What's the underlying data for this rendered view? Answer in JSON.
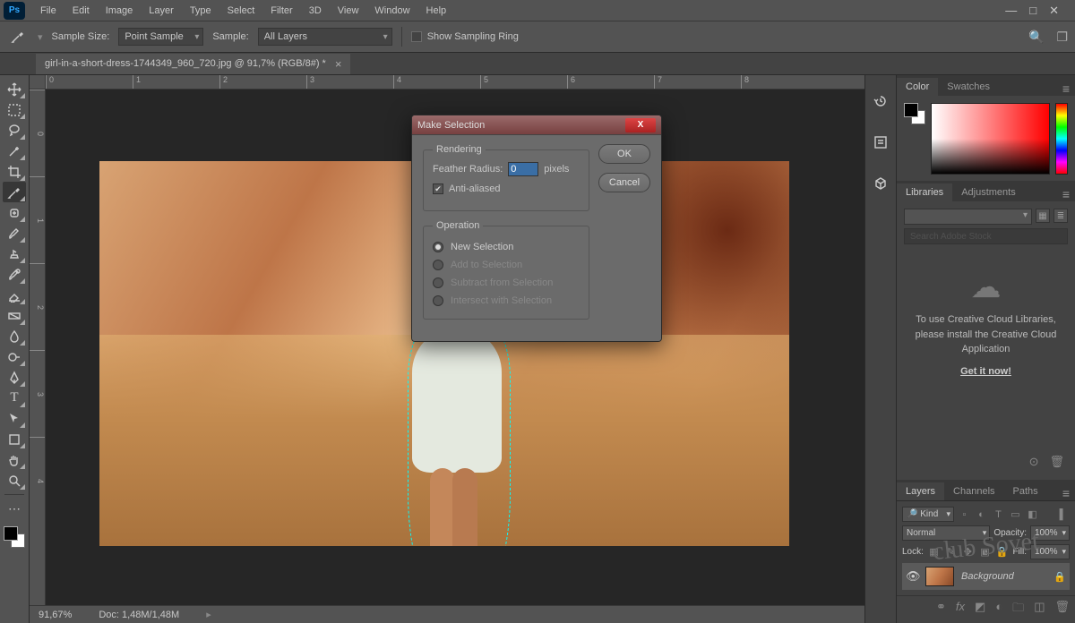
{
  "menubar": {
    "items": [
      "File",
      "Edit",
      "Image",
      "Layer",
      "Type",
      "Select",
      "Filter",
      "3D",
      "View",
      "Window",
      "Help"
    ]
  },
  "window_controls": {
    "min": "—",
    "max": "□",
    "close": "✕"
  },
  "optionsbar": {
    "sample_size_label": "Sample Size:",
    "sample_size_value": "Point Sample",
    "sample_label": "Sample:",
    "sample_value": "All Layers",
    "show_sampling_ring": "Show Sampling Ring"
  },
  "document": {
    "tab_title": "girl-in-a-short-dress-1744349_960_720.jpg @ 91,7% (RGB/8#) *"
  },
  "ruler_h": [
    "0",
    "1",
    "2",
    "3",
    "4",
    "5",
    "6",
    "7",
    "8"
  ],
  "ruler_v": [
    "0",
    "1",
    "2",
    "3",
    "4"
  ],
  "statusbar": {
    "zoom": "91,67%",
    "doc": "Doc: 1,48M/1,48M"
  },
  "color_panel": {
    "tabs": [
      "Color",
      "Swatches"
    ]
  },
  "libraries_panel": {
    "tabs": [
      "Libraries",
      "Adjustments"
    ],
    "search_placeholder": "Search Adobe Stock",
    "message": "To use Creative Cloud Libraries, please install the Creative Cloud Application",
    "cta": "Get it now!"
  },
  "layers_panel": {
    "tabs": [
      "Layers",
      "Channels",
      "Paths"
    ],
    "kind_label": "Kind",
    "blend_mode": "Normal",
    "opacity_label": "Opacity:",
    "opacity_value": "100%",
    "lock_label": "Lock:",
    "fill_label": "Fill:",
    "fill_value": "100%",
    "layer": {
      "name": "Background"
    }
  },
  "dialog": {
    "title": "Make Selection",
    "rendering_legend": "Rendering",
    "feather_label": "Feather Radius:",
    "feather_value": "0",
    "feather_unit": "pixels",
    "antialiased": "Anti-aliased",
    "operation_legend": "Operation",
    "ops": {
      "new": "New Selection",
      "add": "Add to Selection",
      "subtract": "Subtract from Selection",
      "intersect": "Intersect with Selection"
    },
    "ok": "OK",
    "cancel": "Cancel"
  },
  "watermark": "club Sovet"
}
